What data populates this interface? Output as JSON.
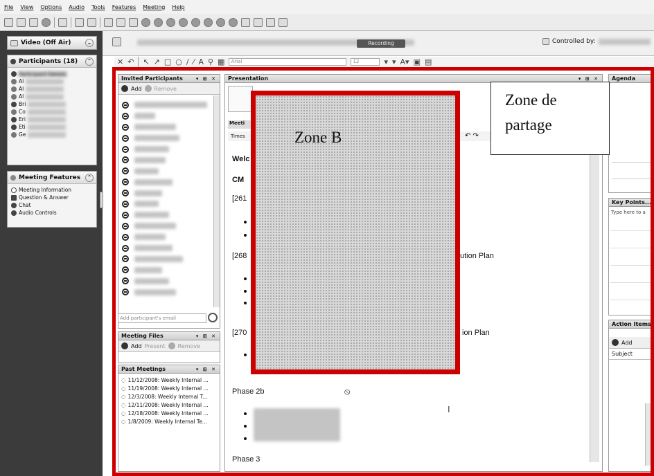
{
  "menu": [
    "File",
    "View",
    "Options",
    "Audio",
    "Tools",
    "Features",
    "Meeting",
    "Help"
  ],
  "sidebar": {
    "video": {
      "title": "Video (Off Air)"
    },
    "participants": {
      "title": "Participants (18)",
      "first_item": "Participant Details",
      "items": [
        "Al",
        "Al",
        "Al",
        "Bri",
        "Co",
        "Eri",
        "Eti",
        "Ge"
      ]
    },
    "features": {
      "title": "Meeting Features",
      "items": [
        "Meeting Information",
        "Question & Answer",
        "Chat",
        "Audio Controls"
      ]
    }
  },
  "session": {
    "recording": "Recording",
    "controlled_by": "Controlled by:"
  },
  "draw_toolbar": {
    "font": "Arial",
    "size": "12"
  },
  "invited": {
    "title": "Invited Participants",
    "add": "Add",
    "remove": "Remove",
    "email_placeholder": "Add participant's email"
  },
  "files": {
    "title": "Meeting Files",
    "add": "Add",
    "present": "Present",
    "remove": "Remove"
  },
  "past": {
    "title": "Past Meetings",
    "items": [
      "11/12/2008: Weekly Internal ...",
      "11/19/2008: Weekly Internal ...",
      "12/3/2008: Weekly Internal T...",
      "12/11/2008: Weekly Internal ...",
      "12/18/2008: Weekly Internal ...",
      "1/8/2009: Weekly Internal Te..."
    ]
  },
  "presentation": {
    "title": "Presentation",
    "tab": "Meeti",
    "toolbar_text": "Times",
    "welcome": "Welc",
    "cm": "CM",
    "item1": "[261",
    "item2": "[268",
    "item2_tail": "ution Plan",
    "item3": "[270",
    "item3_tail": "ion Plan",
    "phase2b": "Phase 2b",
    "phase3": "Phase 3"
  },
  "agenda": {
    "title": "Agenda"
  },
  "keypoints": {
    "title": "Key Points...",
    "placeholder": "Type here to a"
  },
  "actions": {
    "title": "Action Items",
    "add": "Add",
    "column": "Subject"
  },
  "annotations": {
    "zone_b": "Zone B",
    "zone_partage_1": "Zone de",
    "zone_partage_2": "partage"
  },
  "colors": {
    "highlight_border": "#cc0000",
    "sidebar_bg": "#3b3b3b"
  }
}
